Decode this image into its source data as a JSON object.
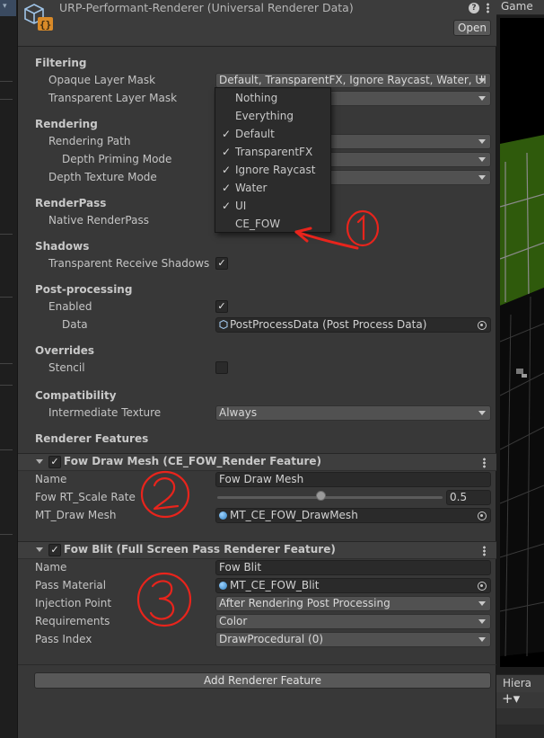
{
  "inspector": {
    "title": "URP-Performant-Renderer (Universal Renderer Data)",
    "open_label": "Open",
    "help_glyph": "?"
  },
  "sections": {
    "filtering": "Filtering",
    "rendering": "Rendering",
    "renderpass": "RenderPass",
    "shadows": "Shadows",
    "postprocessing": "Post-processing",
    "overrides": "Overrides",
    "compatibility": "Compatibility",
    "renderer_features": "Renderer Features"
  },
  "fields": {
    "opaque_layer_mask": {
      "label": "Opaque Layer Mask",
      "value": "Default, TransparentFX, Ignore Raycast, Water, UI"
    },
    "transparent_layer_mask": {
      "label": "Transparent Layer Mask"
    },
    "rendering_path": {
      "label": "Rendering Path"
    },
    "depth_priming_mode": {
      "label": "Depth Priming Mode"
    },
    "depth_texture_mode": {
      "label": "Depth Texture Mode"
    },
    "native_renderpass": {
      "label": "Native RenderPass"
    },
    "transparent_receive_shadows": {
      "label": "Transparent Receive Shadows",
      "checked": true
    },
    "pp_enabled": {
      "label": "Enabled",
      "checked": true
    },
    "pp_data": {
      "label": "Data",
      "value": "PostProcessData (Post Process Data)"
    },
    "stencil": {
      "label": "Stencil",
      "checked": false
    },
    "intermediate_texture": {
      "label": "Intermediate Texture",
      "value": "Always"
    }
  },
  "features": [
    {
      "title": "Fow Draw Mesh (CE_FOW_Render Feature)",
      "enabled": true,
      "name_label": "Name",
      "name_value": "Fow Draw Mesh",
      "scale_label": "Fow RT_Scale Rate",
      "scale_value": "0.5",
      "scale_fraction": 0.5,
      "mesh_label": "MT_Draw Mesh",
      "mesh_value": "MT_CE_FOW_DrawMesh"
    },
    {
      "title": "Fow Blit (Full Screen Pass Renderer Feature)",
      "enabled": true,
      "name_label": "Name",
      "name_value": "Fow Blit",
      "material_label": "Pass Material",
      "material_value": "MT_CE_FOW_Blit",
      "injection_label": "Injection Point",
      "injection_value": "After Rendering Post Processing",
      "requirements_label": "Requirements",
      "requirements_value": "Color",
      "pass_index_label": "Pass Index",
      "pass_index_value": "DrawProcedural (0)"
    }
  ],
  "add_feature_label": "Add Renderer Feature",
  "layer_dropdown": {
    "items": [
      {
        "label": "Nothing",
        "checked": false
      },
      {
        "label": "Everything",
        "checked": false
      },
      {
        "label": "Default",
        "checked": true
      },
      {
        "label": "TransparentFX",
        "checked": true
      },
      {
        "label": "Ignore Raycast",
        "checked": true
      },
      {
        "label": "Water",
        "checked": true
      },
      {
        "label": "UI",
        "checked": true
      },
      {
        "label": "CE_FOW",
        "checked": false
      }
    ],
    "check_glyph": "✓"
  },
  "right_panel": {
    "game_tab": "Game",
    "hierarchy_tab": "Hiera",
    "add_glyph": "+▾"
  },
  "colors": {
    "annotation_red": "#e8241c",
    "game_green": "#2f5a0c"
  }
}
